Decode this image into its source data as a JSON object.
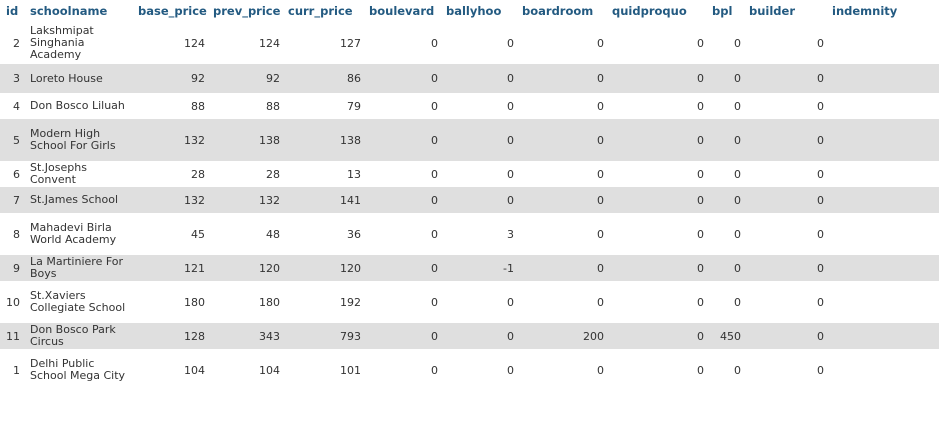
{
  "columns": [
    "id",
    "schoolname",
    "base_price",
    "prev_price",
    "curr_price",
    "boulevard",
    "ballyhoo",
    "boardroom",
    "quidproquo",
    "bpl",
    "builder",
    "indemnity"
  ],
  "rows": [
    [
      "2",
      "Lakshmipat Singhania Academy",
      "124",
      "124",
      "127",
      "0",
      "0",
      "0",
      "0",
      "0",
      "0",
      "0"
    ],
    [
      "3",
      "Loreto House",
      "92",
      "92",
      "86",
      "0",
      "0",
      "0",
      "0",
      "0",
      "0",
      "0"
    ],
    [
      "4",
      "Don Bosco Liluah",
      "88",
      "88",
      "79",
      "0",
      "0",
      "0",
      "0",
      "0",
      "0",
      "0"
    ],
    [
      "5",
      "Modern High School For Girls",
      "132",
      "138",
      "138",
      "0",
      "0",
      "0",
      "0",
      "0",
      "0",
      "0"
    ],
    [
      "6",
      "St.Josephs Convent",
      "28",
      "28",
      "13",
      "0",
      "0",
      "0",
      "0",
      "0",
      "0",
      "0"
    ],
    [
      "7",
      "St.James School",
      "132",
      "132",
      "141",
      "0",
      "0",
      "0",
      "0",
      "0",
      "0",
      "0"
    ],
    [
      "8",
      "Mahadevi Birla World Academy",
      "45",
      "48",
      "36",
      "0",
      "3",
      "0",
      "0",
      "0",
      "0",
      "0"
    ],
    [
      "9",
      "La Martiniere For Boys",
      "121",
      "120",
      "120",
      "0",
      "-1",
      "0",
      "0",
      "0",
      "0",
      "0"
    ],
    [
      "10",
      "St.Xaviers Collegiate School",
      "180",
      "180",
      "192",
      "0",
      "0",
      "0",
      "0",
      "0",
      "0",
      "0"
    ],
    [
      "11",
      "Don Bosco Park Circus",
      "128",
      "343",
      "793",
      "0",
      "0",
      "200",
      "0",
      "450",
      "0",
      "0"
    ],
    [
      "1",
      "Delhi Public School Mega City",
      "104",
      "104",
      "101",
      "0",
      "0",
      "0",
      "0",
      "0",
      "0",
      "0"
    ]
  ]
}
